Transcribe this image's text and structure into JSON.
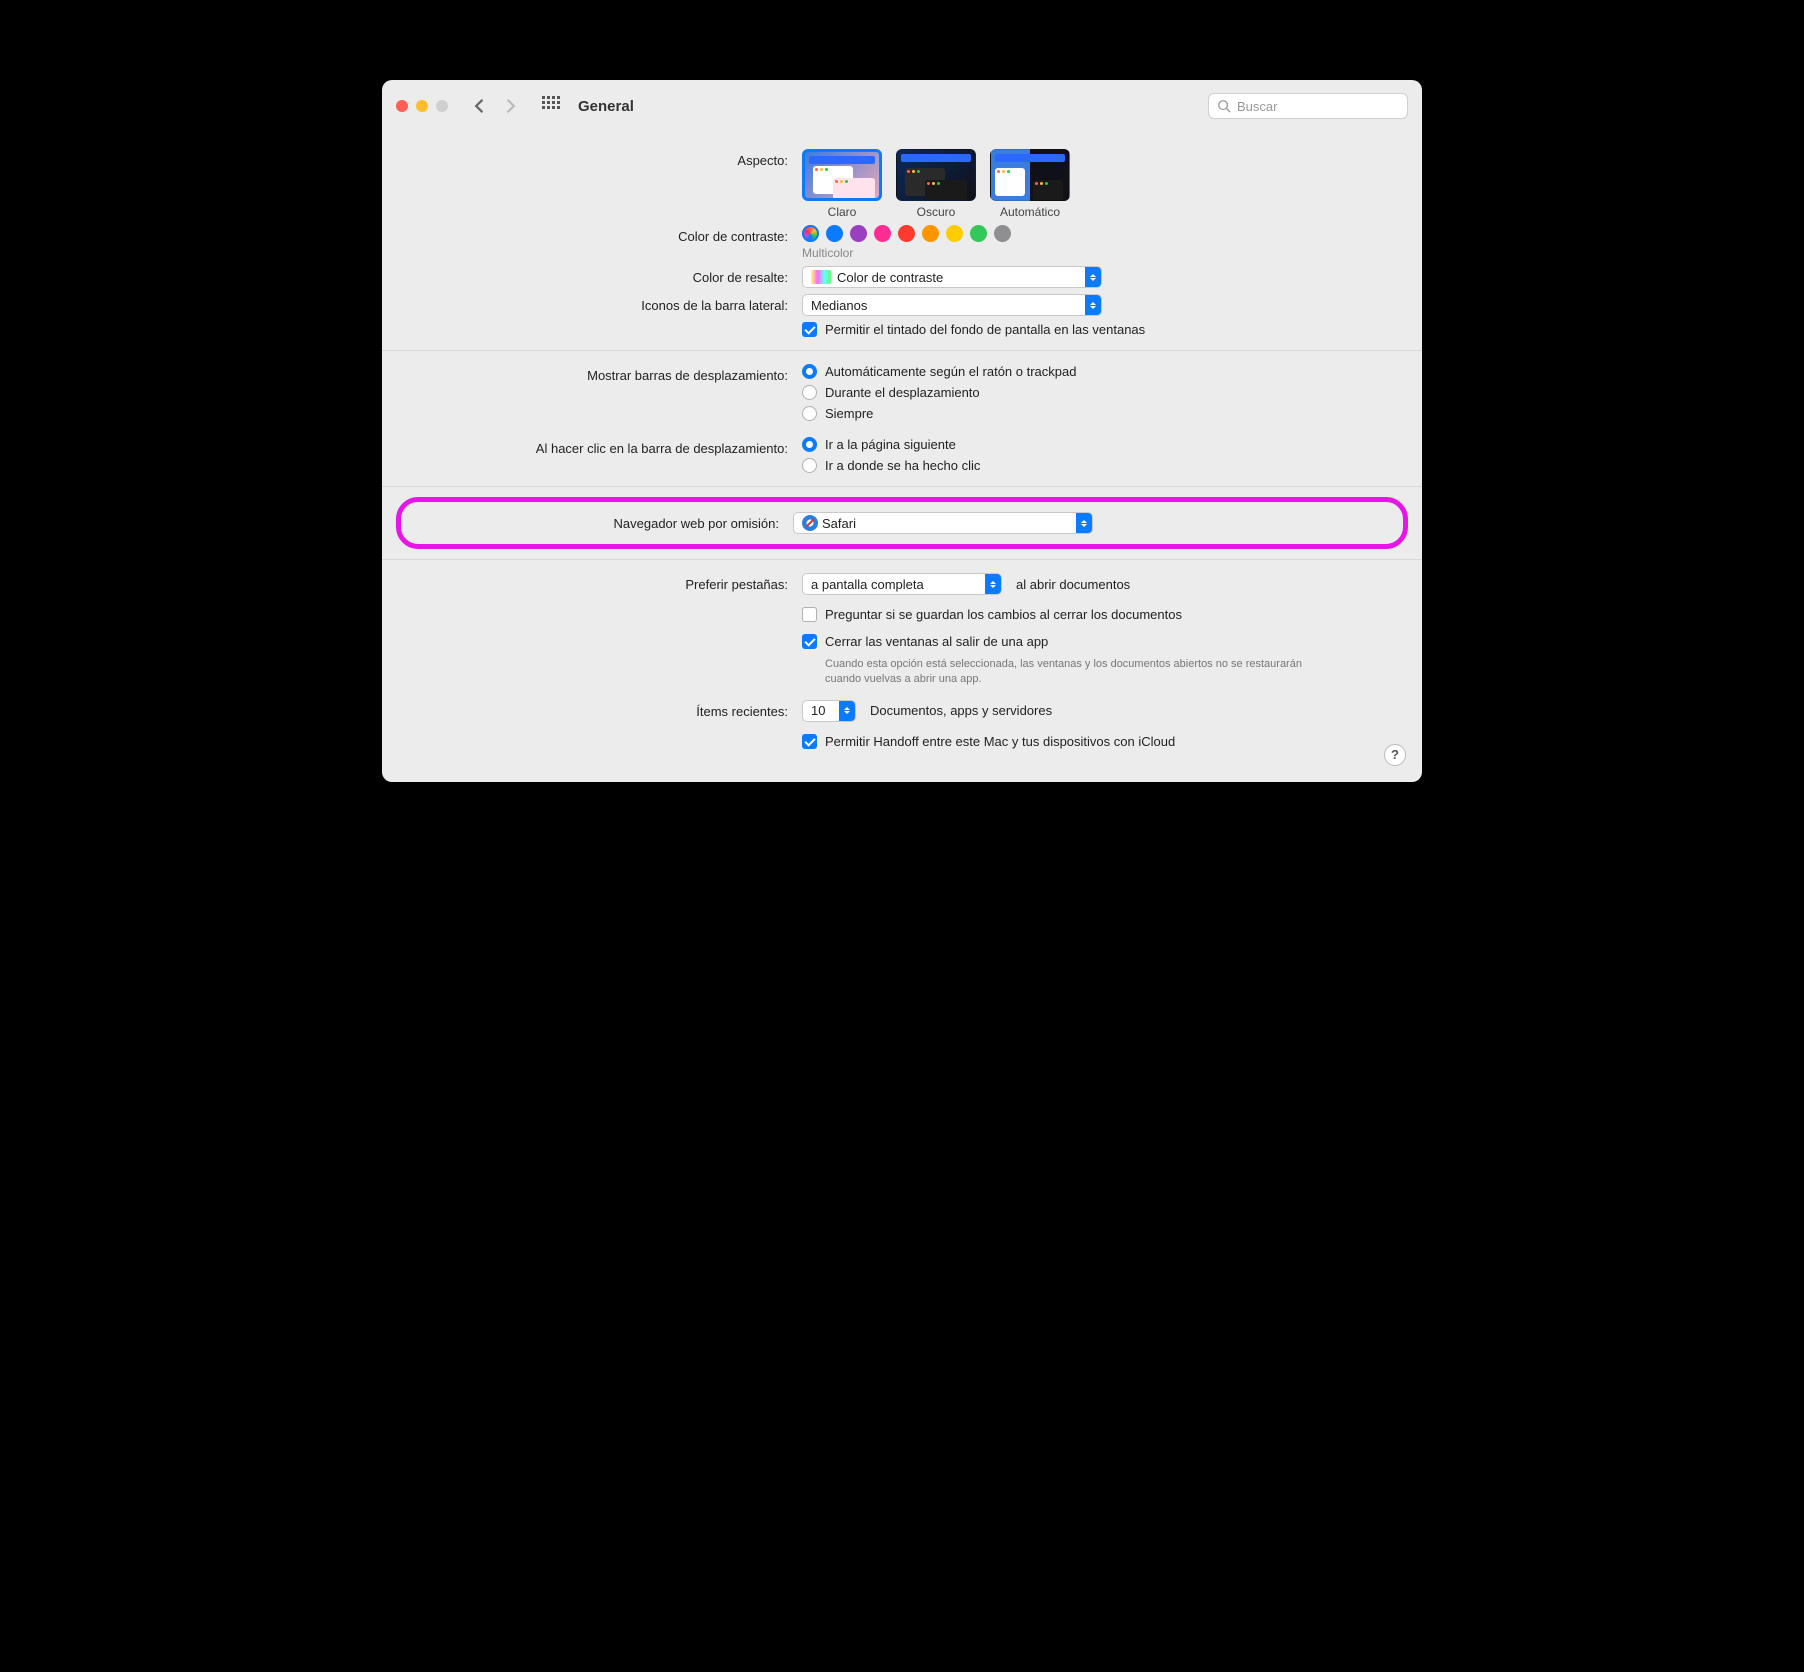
{
  "window": {
    "title": "General"
  },
  "search": {
    "placeholder": "Buscar"
  },
  "appearance": {
    "label": "Aspecto:",
    "options": {
      "light": "Claro",
      "dark": "Oscuro",
      "auto": "Automático"
    }
  },
  "accent": {
    "label": "Color de contraste:",
    "selected_label": "Multicolor",
    "colors": [
      "#0a7aff",
      "#9a3fbf",
      "#ff2d92",
      "#ff3b30",
      "#ff9500",
      "#ffcc00",
      "#34c759",
      "#8e8e93"
    ]
  },
  "highlight": {
    "label": "Color de resalte:",
    "value": "Color de contraste"
  },
  "sidebar_icons": {
    "label": "Iconos de la barra lateral:",
    "value": "Medianos"
  },
  "wallpaper_tint": {
    "label": "Permitir el tintado del fondo de pantalla en las ventanas"
  },
  "scrollbars": {
    "label": "Mostrar barras de desplazamiento:",
    "options": {
      "auto": "Automáticamente según el ratón o trackpad",
      "scrolling": "Durante el desplazamiento",
      "always": "Siempre"
    }
  },
  "scroll_click": {
    "label": "Al hacer clic en la barra de desplazamiento:",
    "options": {
      "next_page": "Ir a la página siguiente",
      "jump": "Ir a donde se ha hecho clic"
    }
  },
  "default_browser": {
    "label": "Navegador web por omisión:",
    "value": "Safari"
  },
  "prefer_tabs": {
    "label": "Preferir pestañas:",
    "value": "a pantalla completa",
    "suffix": "al abrir documentos"
  },
  "ask_save": {
    "label": "Preguntar si se guardan los cambios al cerrar los documentos"
  },
  "close_windows": {
    "label": "Cerrar las ventanas al salir de una app",
    "hint": "Cuando esta opción está seleccionada, las ventanas y los documentos abiertos no se restaurarán cuando vuelvas a abrir una app."
  },
  "recent_items": {
    "label": "Ítems recientes:",
    "value": "10",
    "suffix": "Documentos, apps y servidores"
  },
  "handoff": {
    "label": "Permitir Handoff entre este Mac y tus dispositivos con iCloud"
  },
  "help": "?"
}
